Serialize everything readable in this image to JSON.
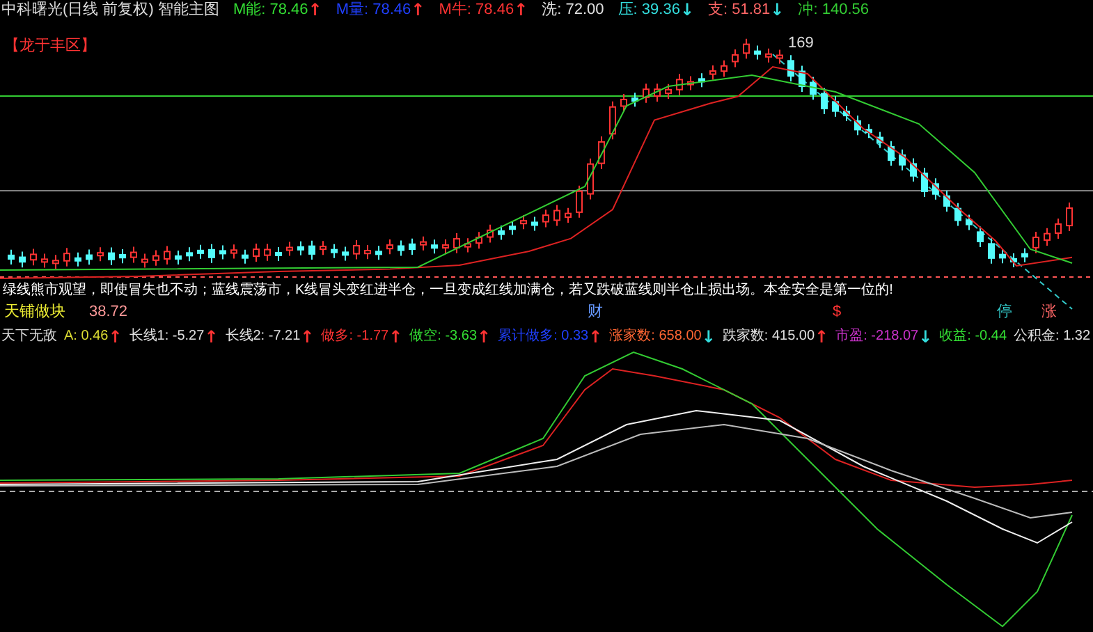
{
  "header": {
    "title": "中科曙光(日线 前复权) 智能主图",
    "stats": [
      {
        "label": "M能:",
        "value": "78.46",
        "color": "#33dd33",
        "arrow": {
          "text": "↑",
          "color": "#ff3333"
        }
      },
      {
        "label": "M量:",
        "value": "78.46",
        "color": "#2040ff",
        "arrow": {
          "text": "↑",
          "color": "#ff3333"
        }
      },
      {
        "label": "M牛:",
        "value": "78.46",
        "color": "#ff3333",
        "arrow": {
          "text": "↑",
          "color": "#ff3333"
        }
      },
      {
        "label": "洗:",
        "value": "72.00",
        "color": "#e0e0e0"
      },
      {
        "label": "压:",
        "value": "39.36",
        "color": "#33dddd",
        "arrow": {
          "text": "↓",
          "color": "#33dddd"
        }
      },
      {
        "label": "支:",
        "value": "51.81",
        "color": "#ff6666",
        "arrow": {
          "text": "↓",
          "color": "#33dddd"
        }
      },
      {
        "label": "冲:",
        "value": "140.56",
        "color": "#33cc33"
      }
    ]
  },
  "main_chart": {
    "zone_label": "【龙于丰区】",
    "peak_label": "169",
    "advice": "绿线熊市观望，即使冒失也不动；蓝线震荡市，K线冒头变红进半仓，一旦变成红线加满仓，若又跌破蓝线则半仓止损出场。本金安全是第一位的!",
    "block_label": "天铺做块",
    "price_label": "38.72",
    "marks": [
      {
        "text": "财",
        "color": "#6699ff"
      },
      {
        "text": "$",
        "color": "#ff3333"
      },
      {
        "text": "停",
        "color": "#33cccc"
      },
      {
        "text": "涨",
        "color": "#ff6666"
      }
    ]
  },
  "indicator": {
    "title": "天下无敌",
    "stats": [
      {
        "label": "A:",
        "value": "0.46",
        "color": "#dddd33",
        "arrow": {
          "text": "↑",
          "color": "#ff3333"
        }
      },
      {
        "label": "长线1:",
        "value": "-5.27",
        "color": "#e0e0e0",
        "arrow": {
          "text": "↑",
          "color": "#ff3333"
        }
      },
      {
        "label": "长线2:",
        "value": "-7.21",
        "color": "#e0e0e0",
        "arrow": {
          "text": "↑",
          "color": "#ff3333"
        }
      },
      {
        "label": "做多:",
        "value": "-1.77",
        "color": "#ff3333",
        "arrow": {
          "text": "↑",
          "color": "#ff3333"
        }
      },
      {
        "label": "做空:",
        "value": "-3.63",
        "color": "#33dd33",
        "arrow": {
          "text": "↑",
          "color": "#ff3333"
        }
      },
      {
        "label": "累计做多:",
        "value": "0.33",
        "color": "#2040ff",
        "arrow": {
          "text": "↑",
          "color": "#ff3333"
        }
      },
      {
        "label": "涨家数:",
        "value": "658.00",
        "color": "#ff6633",
        "arrow": {
          "text": "↓",
          "color": "#33dddd"
        }
      },
      {
        "label": "跌家数:",
        "value": "415.00",
        "color": "#e0e0e0",
        "arrow": {
          "text": "↑",
          "color": "#ff3333"
        }
      },
      {
        "label": "市盈:",
        "value": "-218.07",
        "color": "#cc33cc",
        "arrow": {
          "text": "↓",
          "color": "#33dddd"
        }
      },
      {
        "label": "收益:",
        "value": "-0.44",
        "color": "#33dd33"
      },
      {
        "label": "公积金:",
        "value": "1.32",
        "color": "#e0e0e0"
      }
    ]
  }
}
